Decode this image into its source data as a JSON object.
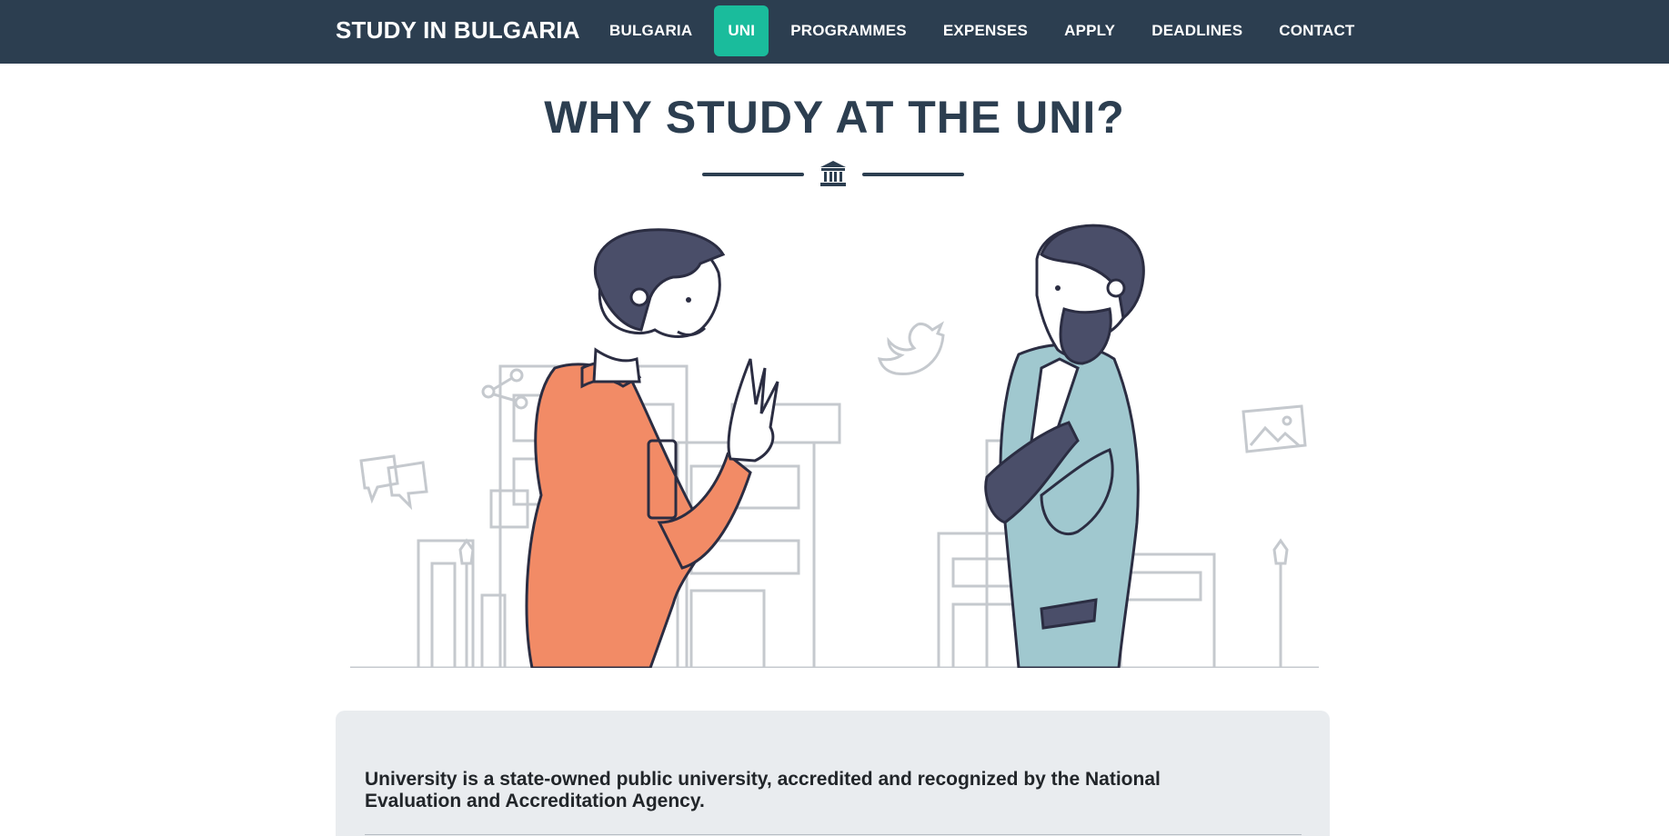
{
  "navbar": {
    "brand": "STUDY IN BULGARIA",
    "items": [
      {
        "label": "BULGARIA",
        "active": false
      },
      {
        "label": "UNI",
        "active": true
      },
      {
        "label": "PROGRAMMES",
        "active": false
      },
      {
        "label": "EXPENSES",
        "active": false
      },
      {
        "label": "APPLY",
        "active": false
      },
      {
        "label": "DEADLINES",
        "active": false
      },
      {
        "label": "CONTACT",
        "active": false
      }
    ]
  },
  "section": {
    "title": "WHY STUDY AT THE UNI?",
    "divider_icon": "university-icon"
  },
  "illustration": {
    "icons": [
      "share-icon",
      "twitter-icon",
      "chat-bubbles-icon",
      "image-icon"
    ]
  },
  "info_card": {
    "text": "University is a state-owned public university, accredited and recognized by the National Evaluation and Accreditation Agency."
  },
  "colors": {
    "navbar_bg": "#2c3e50",
    "accent": "#1abc9c",
    "heading": "#2c3e50",
    "card_bg": "#e9ecef",
    "orange_coat": "#f28b66",
    "teal_coat": "#a0c8cf"
  }
}
